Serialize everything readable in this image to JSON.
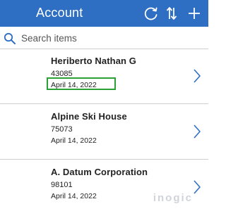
{
  "header": {
    "title": "Account",
    "refresh_icon": "refresh-icon",
    "sort_icon": "sort-icon",
    "add_icon": "add-icon",
    "background_color": "#2e6ec3"
  },
  "search": {
    "placeholder": "Search items",
    "value": "",
    "icon": "search-icon"
  },
  "items": [
    {
      "name": "Heriberto Nathan G",
      "code": "43085",
      "date": "April 14, 2022"
    },
    {
      "name": "Alpine Ski House",
      "code": "75073",
      "date": "April 14, 2022"
    },
    {
      "name": "A. Datum Corporation",
      "code": "98101",
      "date": "April 14, 2022"
    }
  ],
  "highlight_color": "#2aa134",
  "watermark": "inogic"
}
